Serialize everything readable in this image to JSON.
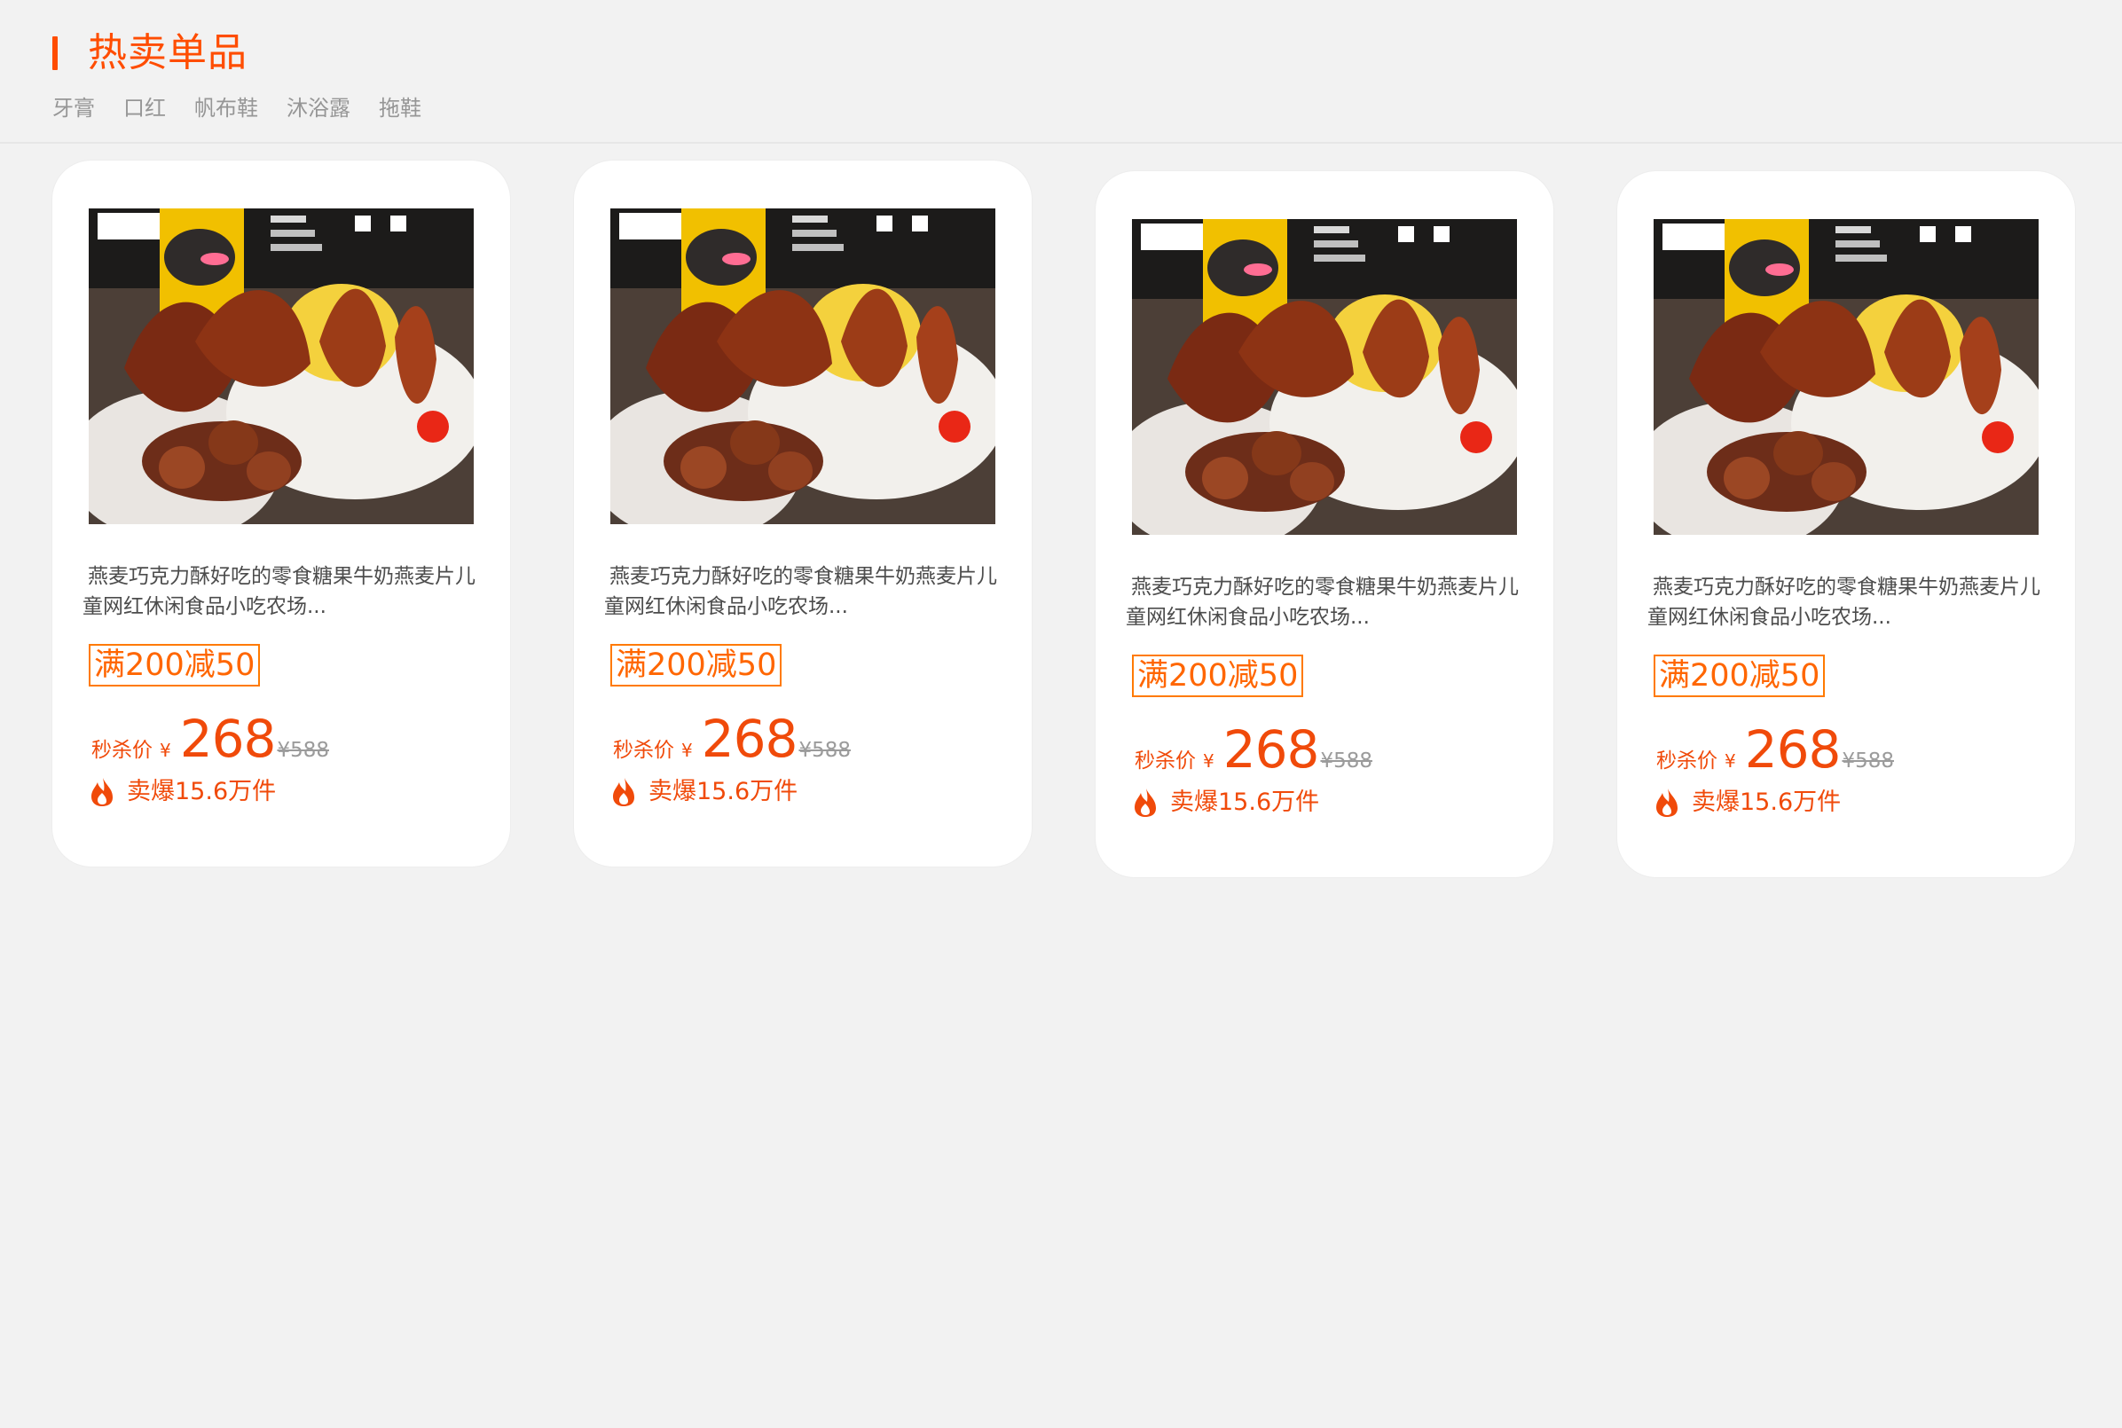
{
  "section": {
    "title": "热卖单品",
    "accent_color": "#ff4d00"
  },
  "tabs": [
    {
      "label": "牙膏"
    },
    {
      "label": "口红"
    },
    {
      "label": "帆布鞋"
    },
    {
      "label": "沐浴露"
    },
    {
      "label": "拖鞋"
    }
  ],
  "products": [
    {
      "image_icon": "duck-snack-product-image",
      "name": "燕麦巧克力酥好吃的零食糖果牛奶燕麦片儿童网红休闲食品小吃农场...",
      "coupon": "满200减50",
      "price_label": "秒杀价",
      "currency": "¥",
      "price": "268",
      "old_price": "¥588",
      "sales": "卖爆15.6万件"
    },
    {
      "image_icon": "duck-snack-product-image",
      "name": "燕麦巧克力酥好吃的零食糖果牛奶燕麦片儿童网红休闲食品小吃农场...",
      "coupon": "满200减50",
      "price_label": "秒杀价",
      "currency": "¥",
      "price": "268",
      "old_price": "¥588",
      "sales": "卖爆15.6万件"
    },
    {
      "image_icon": "duck-snack-product-image",
      "name": "燕麦巧克力酥好吃的零食糖果牛奶燕麦片儿童网红休闲食品小吃农场...",
      "coupon": "满200减50",
      "price_label": "秒杀价",
      "currency": "¥",
      "price": "268",
      "old_price": "¥588",
      "sales": "卖爆15.6万件"
    },
    {
      "image_icon": "duck-snack-product-image",
      "name": "燕麦巧克力酥好吃的零食糖果牛奶燕麦片儿童网红休闲食品小吃农场...",
      "coupon": "满200减50",
      "price_label": "秒杀价",
      "currency": "¥",
      "price": "268",
      "old_price": "¥588",
      "sales": "卖爆15.6万件"
    }
  ],
  "colors": {
    "background": "#f2f2f2",
    "card": "#ffffff",
    "accent_red": "#f04a0a",
    "coupon_orange": "#ff6600",
    "muted_gray": "#969696"
  }
}
